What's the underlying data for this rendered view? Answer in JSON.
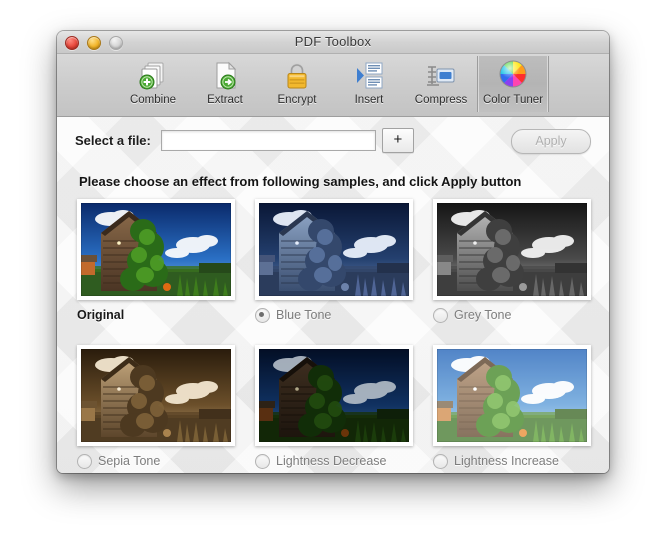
{
  "window": {
    "title": "PDF Toolbox",
    "traffic_lights": [
      {
        "name": "close",
        "color": "#e8483c"
      },
      {
        "name": "minimize",
        "color": "#f2b428"
      },
      {
        "name": "zoom",
        "color": "#d5d5d5"
      }
    ]
  },
  "toolbar": {
    "items": [
      {
        "label": "Combine",
        "icon": "combine-pages-icon",
        "selected": false
      },
      {
        "label": "Extract",
        "icon": "extract-page-icon",
        "selected": false
      },
      {
        "label": "Encrypt",
        "icon": "padlock-icon",
        "selected": false
      },
      {
        "label": "Insert",
        "icon": "insert-page-icon",
        "selected": false
      },
      {
        "label": "Compress",
        "icon": "compress-icon",
        "selected": false
      },
      {
        "label": "Color Tuner",
        "icon": "color-wheel-icon",
        "selected": true
      }
    ]
  },
  "file_row": {
    "label": "Select a file:",
    "input_value": "",
    "input_placeholder": "",
    "add_button_label": "+",
    "apply_button_label": "Apply",
    "apply_enabled": false
  },
  "main": {
    "hint": "Please choose an effect from following samples, and click Apply button",
    "effects": [
      {
        "label": "Original",
        "has_radio": false,
        "selected": false,
        "variant": "original"
      },
      {
        "label": "Blue Tone",
        "has_radio": true,
        "selected": true,
        "variant": "blue"
      },
      {
        "label": "Grey Tone",
        "has_radio": true,
        "selected": false,
        "variant": "grey"
      },
      {
        "label": "Sepia Tone",
        "has_radio": true,
        "selected": false,
        "variant": "sepia"
      },
      {
        "label": "Lightness Decrease",
        "has_radio": true,
        "selected": false,
        "variant": "dark"
      },
      {
        "label": "Lightness Increase",
        "has_radio": true,
        "selected": false,
        "variant": "light"
      }
    ]
  },
  "colors": {
    "window_bg": "#ececec",
    "toolbar_bg": "#cdcdcd",
    "content_bg": "#f0f0f0",
    "label_active": "#1a1a1a",
    "label_muted": "#7d7d7d"
  }
}
